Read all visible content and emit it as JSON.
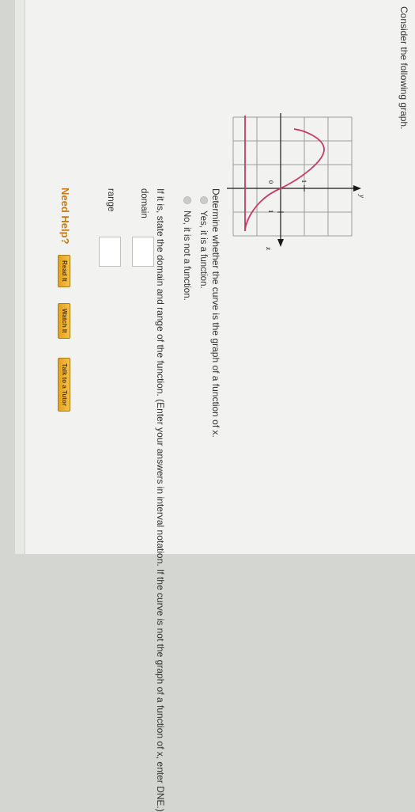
{
  "prompt": "Consider the following graph.",
  "graph": {
    "x_label": "x",
    "y_label": "y",
    "tick_x": "1",
    "tick_y": "1",
    "origin_label": "0",
    "curve_color": "#c8376a"
  },
  "question": "Determine whether the curve is the graph of a function of x.",
  "options": [
    {
      "label": "Yes, it is a function."
    },
    {
      "label": "No, it is not a function."
    }
  ],
  "instructions": "If it is, state the domain and range of the function. (Enter your answers in interval notation. If the curve is not the graph of a function of x, enter DNE.)",
  "domain": {
    "label": "domain",
    "value": ""
  },
  "range": {
    "label": "range",
    "value": ""
  },
  "help": {
    "title": "Need Help?",
    "read": "Read It",
    "watch": "Watch It",
    "tutor": "Talk to a Tutor",
    "button_color": "#f0b530"
  }
}
